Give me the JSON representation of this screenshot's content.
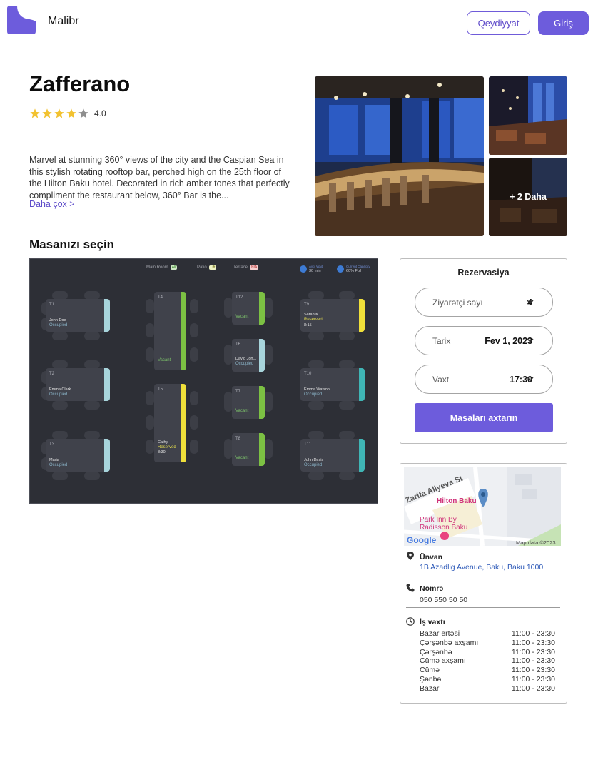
{
  "header": {
    "brand": "Malibr",
    "register_label": "Qeydiyyat",
    "login_label": "Giriş",
    "accent_color": "#6d5cdc"
  },
  "restaurant": {
    "name": "Zafferano",
    "rating": "4.0",
    "stars_filled": 4,
    "stars_total": 5,
    "description": "Marvel at stunning 360° views of the city and the Caspian Sea in this stylish rotating rooftop bar, perched high on the 25th  floor of the Hilton Baku hotel. Decorated in rich amber tones that perfectly compliment the restaurant below, 360° Bar is the...",
    "more_link": "Daha çox >",
    "more_photos": "+ 2 Daha"
  },
  "tables_section": {
    "title": "Masanızı seçin",
    "legend": [
      {
        "label": "Main Room",
        "chip": "All"
      },
      {
        "label": "Patio",
        "chip": "Lift"
      },
      {
        "label": "Terrace",
        "chip": "N/A"
      }
    ],
    "stats": [
      {
        "label": "Avg. Wait",
        "value": "30 min"
      },
      {
        "label": "Current Capacity",
        "value": "60% Full"
      }
    ],
    "tables": [
      {
        "id": "T1",
        "name": "John Doe",
        "status": "Occupied",
        "time": ""
      },
      {
        "id": "T2",
        "name": "Emma Clark",
        "status": "Occupied",
        "time": ""
      },
      {
        "id": "T3",
        "name": "Maria",
        "status": "Occupied",
        "time": ""
      },
      {
        "id": "T4",
        "name": "",
        "status": "Vacant",
        "time": ""
      },
      {
        "id": "T5",
        "name": "Cathy",
        "status": "Reserved",
        "time": "8:30"
      },
      {
        "id": "T12",
        "name": "",
        "status": "Vacant",
        "time": ""
      },
      {
        "id": "T6",
        "name": "David Joh...",
        "status": "Occupied",
        "time": ""
      },
      {
        "id": "T7",
        "name": "",
        "status": "Vacant",
        "time": ""
      },
      {
        "id": "T8",
        "name": "",
        "status": "Vacant",
        "time": ""
      },
      {
        "id": "T9",
        "name": "Sarah K.",
        "status": "Reserved",
        "time": "8:15"
      },
      {
        "id": "T10",
        "name": "Emma Watson",
        "status": "Occupied",
        "time": ""
      },
      {
        "id": "T11",
        "name": "John Davis",
        "status": "Occupied",
        "time": ""
      }
    ],
    "status_colors": {
      "occupied": "#9fd0d8",
      "vacant": "#7cc143",
      "reserved": "#f0e03a",
      "teal": "#3fb5b5"
    }
  },
  "reservation": {
    "title": "Rezervasiya",
    "guests_label": "Ziyarətçi sayı",
    "guests_value": "4",
    "date_label": "Tarix",
    "date_value": "Fev 1, 2023",
    "time_label": "Vaxt",
    "time_value": "17:30",
    "search_label": "Masaları axtarın"
  },
  "info": {
    "map": {
      "street": "Zarifa Aliyeva St",
      "poi_main": "Hilton Baku",
      "poi_secondary": "Park Inn By Radisson Baku",
      "provider": "Google",
      "credit": "Map data ©2023"
    },
    "address_label": "Ünvan",
    "address_value": "1B Azadlig Avenue, Baku, Baku 1000",
    "phone_label": "Nömrə",
    "phone_value": "050 550 50 50",
    "hours_label": "İş vaxtı",
    "hours": [
      {
        "day": "Bazar ertəsi",
        "time": "11:00 - 23:30"
      },
      {
        "day": "Çərşənbə axşamı",
        "time": "11:00 - 23:30"
      },
      {
        "day": "Çərşənbə",
        "time": "11:00 - 23:30"
      },
      {
        "day": "Cümə axşamı",
        "time": "11:00 - 23:30"
      },
      {
        "day": "Cümə",
        "time": "11:00 - 23:30"
      },
      {
        "day": "Şənbə",
        "time": "11:00 - 23:30"
      },
      {
        "day": "Bazar",
        "time": "11:00 - 23:30"
      }
    ]
  }
}
